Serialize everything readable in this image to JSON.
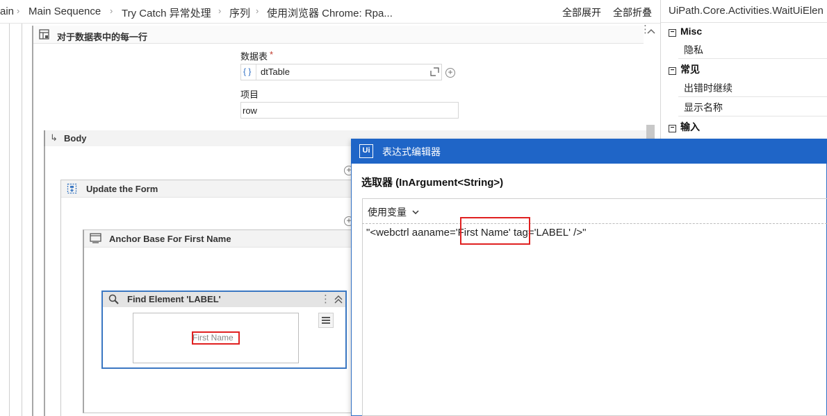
{
  "breadcrumb": {
    "items": [
      "ain",
      "Main Sequence",
      "Try Catch 异常处理",
      "序列",
      "使用浏览器 Chrome: Rpa..."
    ],
    "separator": "›",
    "expand_all": "全部展开",
    "collapse_all": "全部折叠"
  },
  "foreach": {
    "title": "对于数据表中的每一行",
    "datatable_label": "数据表",
    "required_mark": "*",
    "datatable_value": "dtTable",
    "item_label": "项目",
    "item_value": "row",
    "brace_icon": "{ }"
  },
  "body": {
    "title": "Body"
  },
  "update_form": {
    "title": "Update the Form"
  },
  "anchor": {
    "title": "Anchor Base For First Name"
  },
  "find_element": {
    "title": "Find Element 'LABEL'",
    "preview_text": "First Name"
  },
  "properties": {
    "title": "UiPath.Core.Activities.WaitUiElen",
    "categories": [
      {
        "name": "Misc",
        "items": [
          "隐私"
        ]
      },
      {
        "name": "常见",
        "items": [
          "出错时继续",
          "显示名称"
        ]
      },
      {
        "name": "输入",
        "items": []
      }
    ],
    "collapse_glyph": "−"
  },
  "expression_editor": {
    "logo": "Ui",
    "title": "表达式编辑器",
    "subtitle": "选取器 (InArgument<String>)",
    "use_variable": "使用变量",
    "chevron": "⌄",
    "code": "\"<webctrl aaname='First Name' tag='LABEL' />\""
  },
  "colors": {
    "accent_blue": "#1f65c7",
    "highlight_red": "#e02020",
    "selected_border": "#3a77c2"
  }
}
